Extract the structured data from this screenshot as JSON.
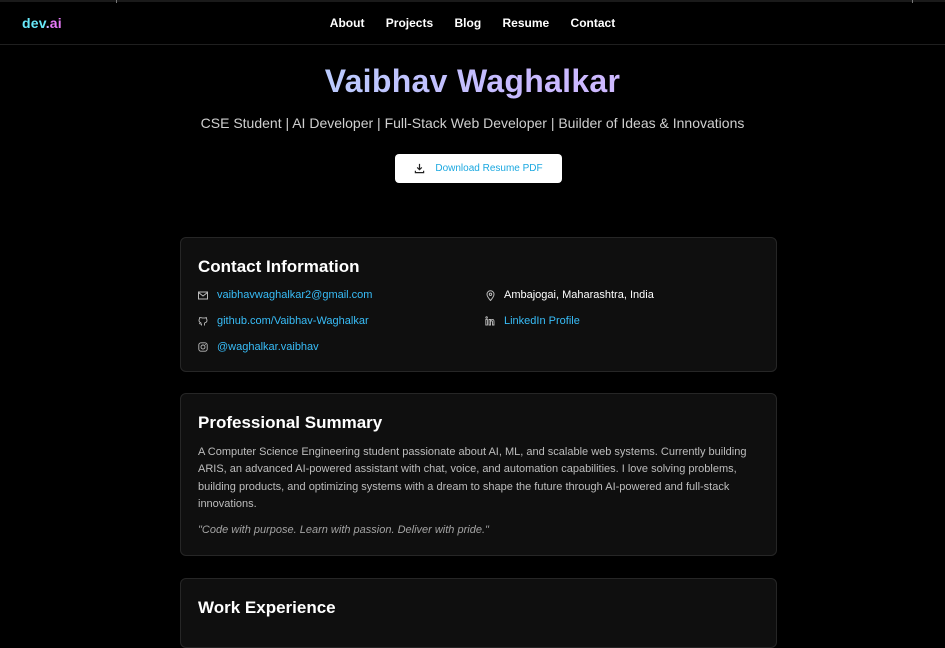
{
  "nav": {
    "logo": {
      "part1": "dev",
      "part2": ".",
      "part3": "ai"
    },
    "links": [
      "About",
      "Projects",
      "Blog",
      "Resume",
      "Contact"
    ]
  },
  "hero": {
    "name": "Vaibhav Waghalkar",
    "tagline": "CSE Student | AI Developer | Full-Stack Web Developer | Builder of Ideas & Innovations",
    "download_label": "Download Resume PDF"
  },
  "contact": {
    "title": "Contact Information",
    "email": "vaibhavwaghalkar2@gmail.com",
    "location": "Ambajogai, Maharashtra, India",
    "github": "github.com/Vaibhav-Waghalkar",
    "linkedin": "LinkedIn Profile",
    "instagram": "@waghalkar.vaibhav"
  },
  "summary": {
    "title": "Professional Summary",
    "body": "A Computer Science Engineering student passionate about AI, ML, and scalable web systems. Currently building ARIS, an advanced AI-powered assistant with chat, voice, and automation capabilities. I love solving problems, building products, and optimizing systems with a dream to shape the future through AI-powered and full-stack innovations.",
    "quote": "\"Code with purpose. Learn with passion. Deliver with pride.\""
  },
  "work": {
    "title": "Work Experience"
  },
  "colors": {
    "accent_link": "#38bdf8",
    "background": "#000000",
    "card": "#0f0f0f"
  }
}
